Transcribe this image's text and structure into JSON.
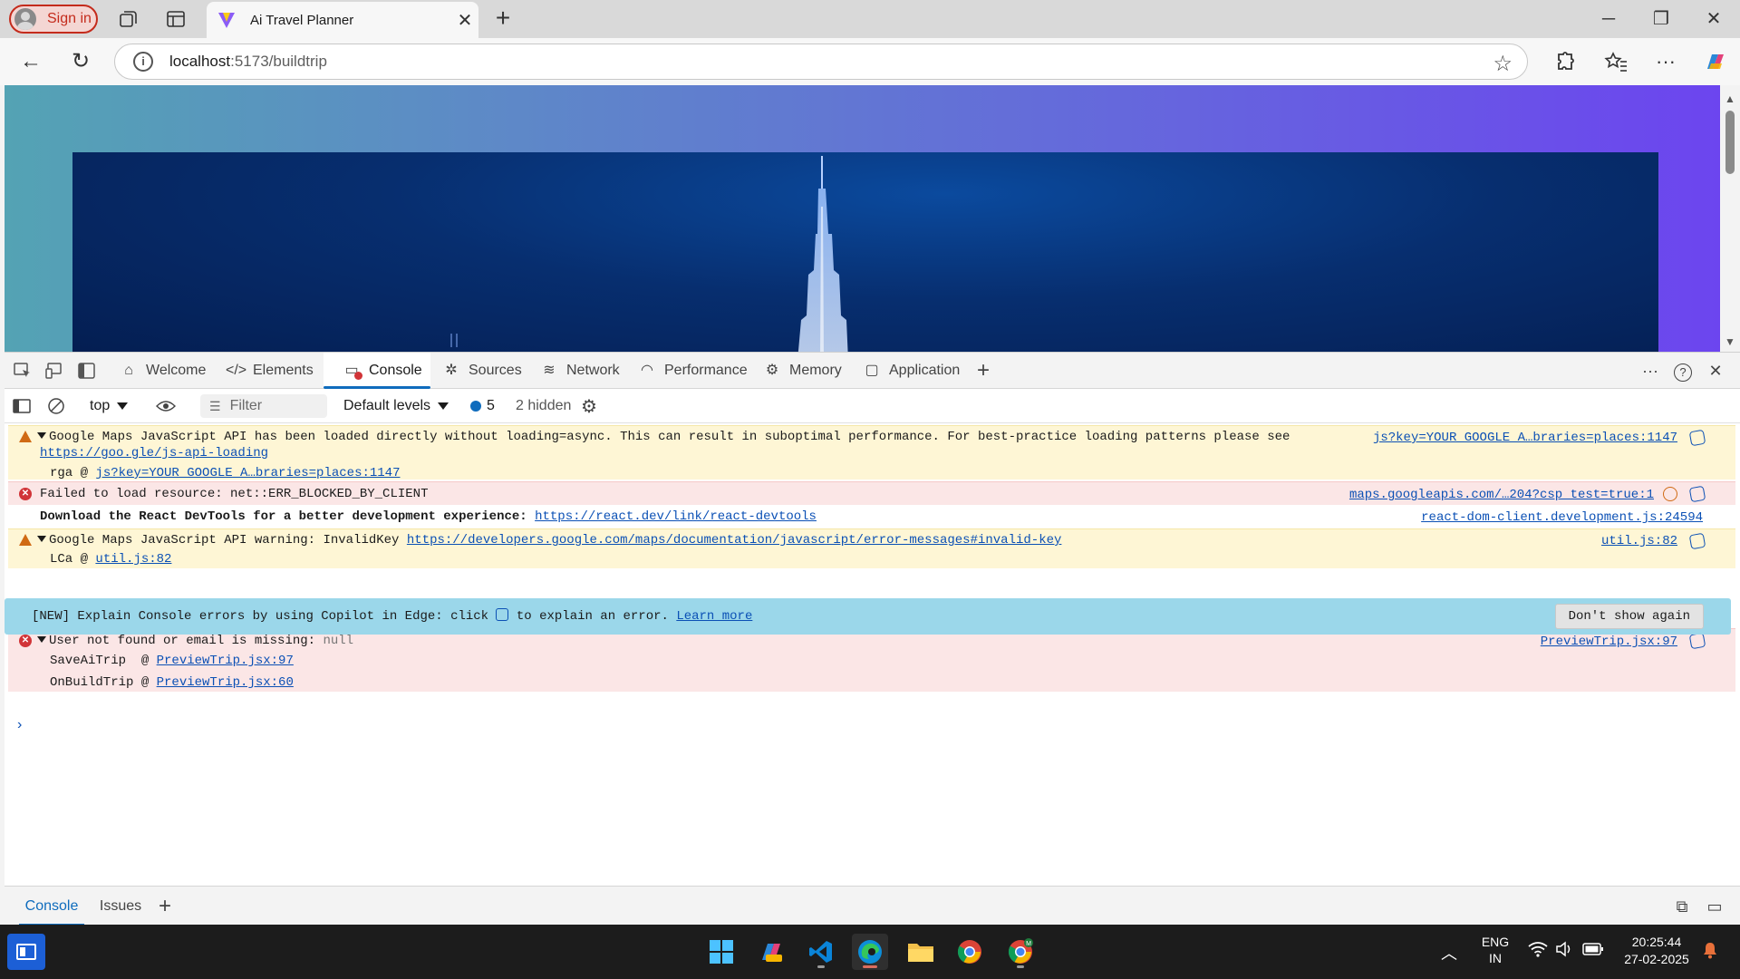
{
  "browser": {
    "signin_label": "Sign in",
    "tab_title": "Ai Travel Planner",
    "url_host": "localhost",
    "url_path": ":5173/buildtrip"
  },
  "devtools": {
    "tabs": [
      {
        "label": "Welcome",
        "icon": "home-icon"
      },
      {
        "label": "Elements",
        "icon": "code-icon"
      },
      {
        "label": "Console",
        "icon": "console-icon"
      },
      {
        "label": "Sources",
        "icon": "bug-icon"
      },
      {
        "label": "Network",
        "icon": "wifi-icon"
      },
      {
        "label": "Performance",
        "icon": "gauge-icon"
      },
      {
        "label": "Memory",
        "icon": "chip-icon"
      },
      {
        "label": "Application",
        "icon": "window-icon"
      }
    ],
    "toolbar": {
      "context": "top",
      "filter_placeholder": "Filter",
      "levels": "Default levels",
      "message_count": "5",
      "hidden": "2 hidden"
    },
    "messages": {
      "m1": {
        "text": "Google Maps JavaScript API has been loaded directly without loading=async. This can result in suboptimal performance. For best-practice loading patterns please see",
        "link": "https://goo.gle/js-api-loading",
        "source": "js?key=YOUR_GOOGLE_A…braries=places:1147",
        "stack_fn": "rga @ ",
        "stack_link": "js?key=YOUR_GOOGLE_A…braries=places:1147"
      },
      "m2": {
        "text": "Failed to load resource: net::ERR_BLOCKED_BY_CLIENT",
        "source": "maps.googleapis.com/…204?csp_test=true:1"
      },
      "m3": {
        "text": "Download the React DevTools for a better development experience: ",
        "link": "https://react.dev/link/react-devtools",
        "source": "react-dom-client.development.js:24594"
      },
      "m4": {
        "text": "Google Maps JavaScript API warning: InvalidKey ",
        "link": "https://developers.google.com/maps/documentation/javascript/error-messages#invalid-key",
        "source": "util.js:82",
        "stack_fn": "LCa @ ",
        "stack_link": "util.js:82"
      },
      "banner": {
        "text_before": "[NEW] Explain Console errors by using Copilot in Edge: click ",
        "text_after": " to explain an error. ",
        "learn_more": "Learn more",
        "dismiss": "Don't show again"
      },
      "m5": {
        "text": "User not found or email is missing: ",
        "value": "null",
        "source": "PreviewTrip.jsx:97",
        "stack1_fn": "SaveAiTrip  @ ",
        "stack1_link": "PreviewTrip.jsx:97",
        "stack2_fn": "OnBuildTrip @ ",
        "stack2_link": "PreviewTrip.jsx:60"
      }
    },
    "drawer": {
      "tabs": [
        "Console",
        "Issues"
      ]
    }
  },
  "taskbar": {
    "lang_line1": "ENG",
    "lang_line2": "IN",
    "time": "20:25:44",
    "date": "27-02-2025"
  }
}
